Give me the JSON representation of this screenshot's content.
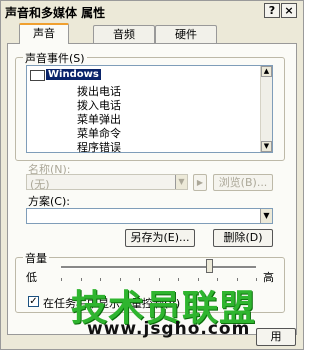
{
  "window": {
    "title": "声音和多媒体 属性",
    "help_glyph": "?",
    "close_glyph": "×"
  },
  "tabs": [
    {
      "label": "声音"
    },
    {
      "label": "音频"
    },
    {
      "label": "硬件"
    }
  ],
  "events_group": {
    "label": "声音事件(S)",
    "items": [
      {
        "label": "Windows",
        "selected": true
      },
      {
        "label": "拨出电话"
      },
      {
        "label": "拨入电话"
      },
      {
        "label": "菜单弹出"
      },
      {
        "label": "菜单命令"
      },
      {
        "label": "程序错误"
      }
    ]
  },
  "name_row": {
    "label": "名称(N):",
    "value": "(无)",
    "play_glyph": "▶",
    "browse_label": "浏览(B)..."
  },
  "scheme": {
    "label": "方案(C):",
    "value": "",
    "save_as_label": "另存为(E)...",
    "delete_label": "删除(D)"
  },
  "volume": {
    "label": "音量",
    "low_label": "低",
    "high_label": "高",
    "level_fraction": 0.76
  },
  "tray_checkbox": {
    "label": "在任务栏中显示音量控制(V)",
    "checked": true,
    "check_glyph": "✓"
  },
  "bottom_button": {
    "label": "用"
  },
  "watermark": {
    "text": "技术员联盟",
    "url": "www.jsgho.com"
  },
  "icons": {
    "speaker": "speaker-icon",
    "scroll_up": "▲",
    "scroll_down": "▼",
    "dropdown": "▼"
  }
}
